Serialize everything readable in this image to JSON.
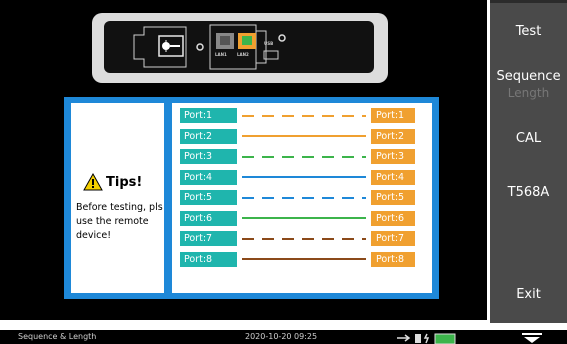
{
  "side_menu": {
    "test": "Test",
    "sequence": "Sequence",
    "length": "Length",
    "cal": "CAL",
    "standard": "T568A",
    "blank": "",
    "exit": "Exit"
  },
  "device": {
    "lan1": "LAN1",
    "lan2": "LAN2",
    "usb": "USB"
  },
  "tips": {
    "title": "Tips!",
    "message": "Before testing, pls use the remote device!"
  },
  "ports": [
    {
      "left": "Port:1",
      "right": "Port:1",
      "wire_color": "#f0a030",
      "pattern": "striped"
    },
    {
      "left": "Port:2",
      "right": "Port:2",
      "wire_color": "#f0a030",
      "pattern": "solid"
    },
    {
      "left": "Port:3",
      "right": "Port:3",
      "wire_color": "#3cb44b",
      "pattern": "striped"
    },
    {
      "left": "Port:4",
      "right": "Port:4",
      "wire_color": "#1e88d8",
      "pattern": "solid"
    },
    {
      "left": "Port:5",
      "right": "Port:5",
      "wire_color": "#1e88d8",
      "pattern": "striped"
    },
    {
      "left": "Port:6",
      "right": "Port:6",
      "wire_color": "#3cb44b",
      "pattern": "solid"
    },
    {
      "left": "Port:7",
      "right": "Port:7",
      "wire_color": "#8b4a1a",
      "pattern": "striped"
    },
    {
      "left": "Port:8",
      "right": "Port:8",
      "wire_color": "#8b4a1a",
      "pattern": "solid"
    }
  ],
  "status": {
    "mode": "Sequence & Length",
    "datetime": "2020-10-20 09:25"
  },
  "colors": {
    "panel_blue": "#1e88d8",
    "port_teal": "#1fb5ad",
    "port_orange": "#f0a030",
    "button_gray": "#4a4a4a"
  }
}
